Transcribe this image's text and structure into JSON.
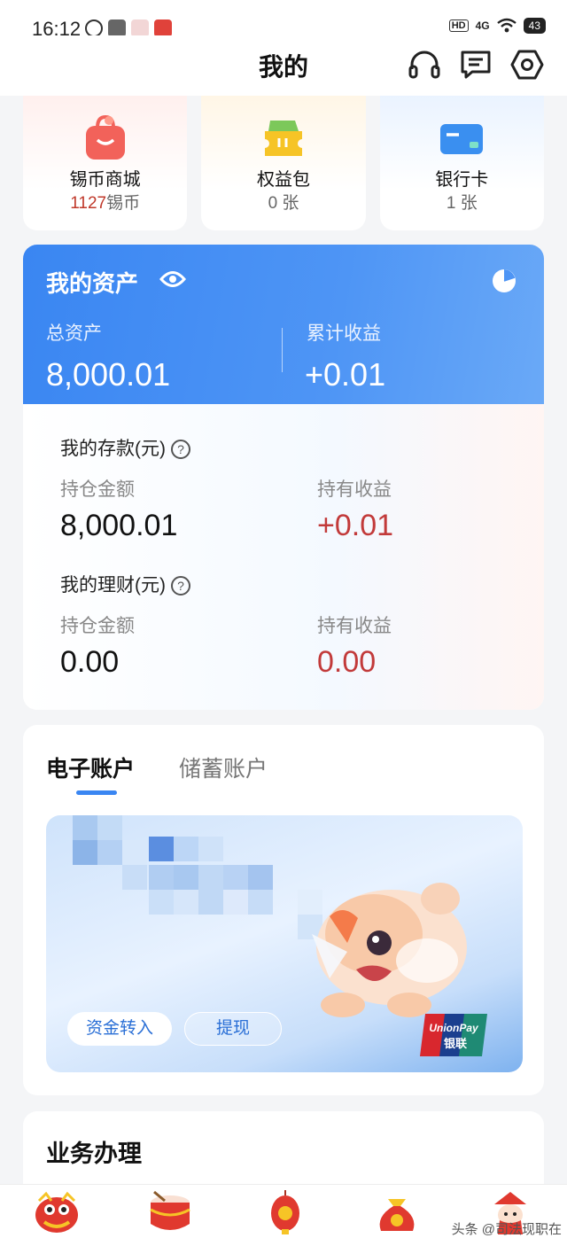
{
  "status_bar": {
    "time": "16:12",
    "network": "4G",
    "battery": "43"
  },
  "header": {
    "title": "我的"
  },
  "quick_cards": [
    {
      "label": "锡币商城",
      "value": "1127",
      "unit": "锡币",
      "icon": "shopping-bag-icon"
    },
    {
      "label": "权益包",
      "value": "0 张",
      "icon": "ticket-icon"
    },
    {
      "label": "银行卡",
      "value": "1 张",
      "icon": "bank-card-icon"
    }
  ],
  "assets": {
    "title": "我的资产",
    "total_label": "总资产",
    "total_value": "8,000.01",
    "earnings_label": "累计收益",
    "earnings_value": "+0.01",
    "deposits": {
      "title": "我的存款(元)",
      "holding_label": "持仓金额",
      "holding_value": "8,000.01",
      "income_label": "持有收益",
      "income_value": "+0.01"
    },
    "wealth": {
      "title": "我的理财(元)",
      "holding_label": "持仓金额",
      "holding_value": "0.00",
      "income_label": "持有收益",
      "income_value": "0.00"
    }
  },
  "e_account": {
    "tabs": [
      "电子账户",
      "储蓄账户"
    ],
    "active_tab": 0,
    "transfer_in_label": "资金转入",
    "withdraw_label": "提现",
    "unionpay_text": "UnionPay",
    "unionpay_cn": "银联"
  },
  "business": {
    "title": "业务办理"
  },
  "watermark": "头条 @司法现职在",
  "colors": {
    "accent_blue": "#3a86f2",
    "income_red": "#c23a3a"
  }
}
